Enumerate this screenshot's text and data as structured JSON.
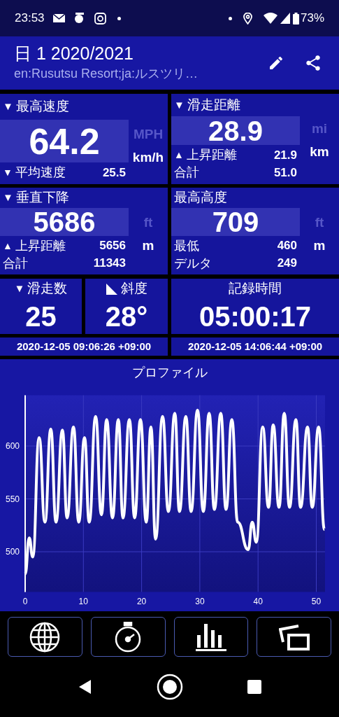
{
  "status_bar": {
    "time": "23:53",
    "battery": "73%"
  },
  "header": {
    "title": "日 1 2020/2021",
    "subtitle": "en:Rusutsu Resort;ja:ルスツリ…"
  },
  "stats": [
    {
      "arrow": "▼",
      "label": "最高速度",
      "value": "64.2",
      "units": [
        {
          "label": "MPH",
          "selected": false
        },
        {
          "label": "km/h",
          "selected": true
        }
      ],
      "rows": [
        {
          "arrow": "▼",
          "label": "平均速度",
          "value": "25.5"
        }
      ]
    },
    {
      "arrow": "▼",
      "label": "滑走距離",
      "value": "28.9",
      "units": [
        {
          "label": "mi",
          "selected": false
        },
        {
          "label": "km",
          "selected": true
        }
      ],
      "rows": [
        {
          "arrow": "▲",
          "label": "上昇距離",
          "value": "21.9"
        },
        {
          "label": "合計",
          "value": "51.0"
        }
      ]
    },
    {
      "arrow": "▼",
      "label": "垂直下降",
      "value": "5686",
      "units": [
        {
          "label": "ft",
          "selected": false
        },
        {
          "label": "m",
          "selected": true
        }
      ],
      "rows": [
        {
          "arrow": "▲",
          "label": "上昇距離",
          "value": "5656"
        },
        {
          "label": "合計",
          "value": "11343"
        }
      ]
    },
    {
      "label": "最高高度",
      "value": "709",
      "units": [
        {
          "label": "ft",
          "selected": false
        },
        {
          "label": "m",
          "selected": true
        }
      ],
      "rows": [
        {
          "label": "最低",
          "value": "460"
        },
        {
          "label": "デルタ",
          "value": "249"
        }
      ]
    }
  ],
  "small_stats": [
    {
      "kind": "arrow",
      "arrow": "▼",
      "label": "滑走数",
      "value": "25"
    },
    {
      "kind": "slope",
      "label": "斜度",
      "value": "28°"
    },
    {
      "kind": "plain",
      "label": "記録時間",
      "value": "05:00:17"
    }
  ],
  "times": [
    "2020-12-05 09:06:26 +09:00",
    "2020-12-05 14:06:44 +09:00"
  ],
  "profile": {
    "chart_data": {
      "type": "line",
      "title": "プロファイル",
      "xlim": [
        0,
        51.5
      ],
      "ylim": [
        462,
        648
      ],
      "xticks": [
        0,
        10,
        20,
        30,
        40,
        50
      ],
      "yticks": [
        500,
        550,
        600
      ],
      "x": [
        0,
        0.7,
        1.3,
        2.4,
        3.4,
        4.4,
        5.3,
        6.4,
        7.2,
        8.3,
        9.2,
        10.2,
        11.0,
        12.1,
        13.1,
        14.0,
        15.0,
        16.0,
        16.8,
        17.9,
        18.8,
        19.8,
        20.8,
        21.6,
        22.4,
        23.6,
        24.6,
        25.7,
        26.5,
        27.6,
        28.5,
        29.6,
        30.6,
        31.6,
        32.5,
        33.6,
        34.5,
        35.5,
        36.5,
        38.3,
        39.0,
        39.7,
        40.8,
        41.8,
        42.6,
        43.6,
        44.5,
        45.4,
        46.5,
        47.3,
        48.5,
        49.3,
        50.4,
        51.4
      ],
      "grid": true,
      "series": [
        {
          "color": "#ffffff",
          "values": [
            479,
            513,
            495,
            608,
            528,
            616,
            528,
            615,
            532,
            618,
            528,
            608,
            528,
            628,
            535,
            625,
            532,
            625,
            532,
            625,
            532,
            625,
            528,
            618,
            512,
            628,
            538,
            631,
            538,
            628,
            538,
            634,
            538,
            631,
            540,
            631,
            540,
            625,
            528,
            502,
            528,
            509,
            618,
            542,
            620,
            542,
            631,
            542,
            625,
            542,
            618,
            542,
            618,
            521
          ]
        }
      ]
    }
  },
  "toolbar": [
    {
      "kind": "globe"
    },
    {
      "kind": "stopwatch"
    },
    {
      "kind": "bars"
    },
    {
      "kind": "screens"
    }
  ]
}
